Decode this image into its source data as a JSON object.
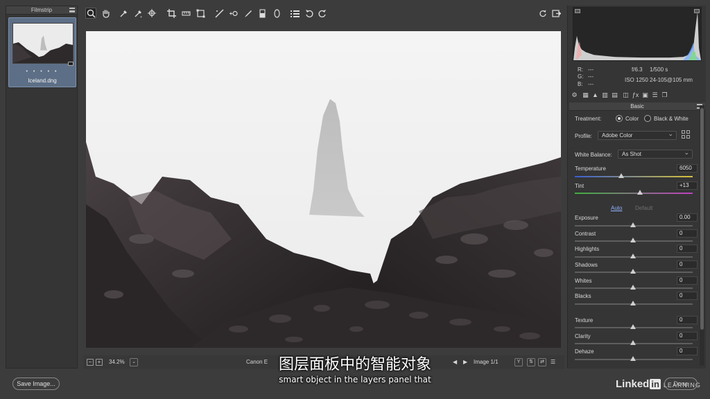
{
  "filmstrip": {
    "title": "Filmstrip",
    "item": {
      "name": "Iceland.dng",
      "rating_dots": "• • • • •"
    }
  },
  "toolbar": {
    "tools": [
      "zoom-icon",
      "hand-icon",
      "white-balance-icon",
      "color-sampler-icon",
      "targeted-adjustment-icon",
      "crop-icon",
      "straighten-icon",
      "transform-icon",
      "spot-removal-icon",
      "red-eye-icon",
      "adjustment-brush-icon",
      "graduated-filter-icon",
      "radial-filter-icon",
      "presets-list-icon",
      "rotate-ccw-icon",
      "rotate-cw-icon"
    ],
    "right_tools": [
      "sync-icon",
      "export-icon"
    ]
  },
  "status": {
    "zoom": "34.2%",
    "camera_text": "Canon E",
    "image_counter": "Image 1/1"
  },
  "readout": {
    "r_label": "R:",
    "r_val": "---",
    "g_label": "G:",
    "g_val": "---",
    "b_label": "B:",
    "b_val": "---",
    "aperture": "f/6.3",
    "shutter": "1/500 s",
    "iso": "ISO 1250",
    "lens": "24-105@105 mm"
  },
  "panel": {
    "title": "Basic",
    "treatment_label": "Treatment:",
    "treatment_color": "Color",
    "treatment_bw": "Black & White",
    "profile_label": "Profile:",
    "profile_value": "Adobe Color",
    "wb_label": "White Balance:",
    "wb_value": "As Shot",
    "temperature_label": "Temperature",
    "temperature_value": "6050",
    "tint_label": "Tint",
    "tint_value": "+13",
    "auto_label": "Auto",
    "default_label": "Default",
    "sliders": [
      {
        "label": "Exposure",
        "value": "0.00"
      },
      {
        "label": "Contrast",
        "value": "0"
      },
      {
        "label": "Highlights",
        "value": "0"
      },
      {
        "label": "Shadows",
        "value": "0"
      },
      {
        "label": "Whites",
        "value": "0"
      },
      {
        "label": "Blacks",
        "value": "0"
      },
      {
        "label": "Texture",
        "value": "0"
      },
      {
        "label": "Clarity",
        "value": "0"
      },
      {
        "label": "Dehaze",
        "value": "0"
      }
    ]
  },
  "bottom": {
    "save_label": "Save Image...",
    "done_label": "Done",
    "logo_text": "Linked",
    "logo_in": "in",
    "logo_learning": "LEARNING"
  },
  "subtitles": {
    "cn": "图层面板中的智能对象",
    "en": "smart object in the layers panel that"
  }
}
